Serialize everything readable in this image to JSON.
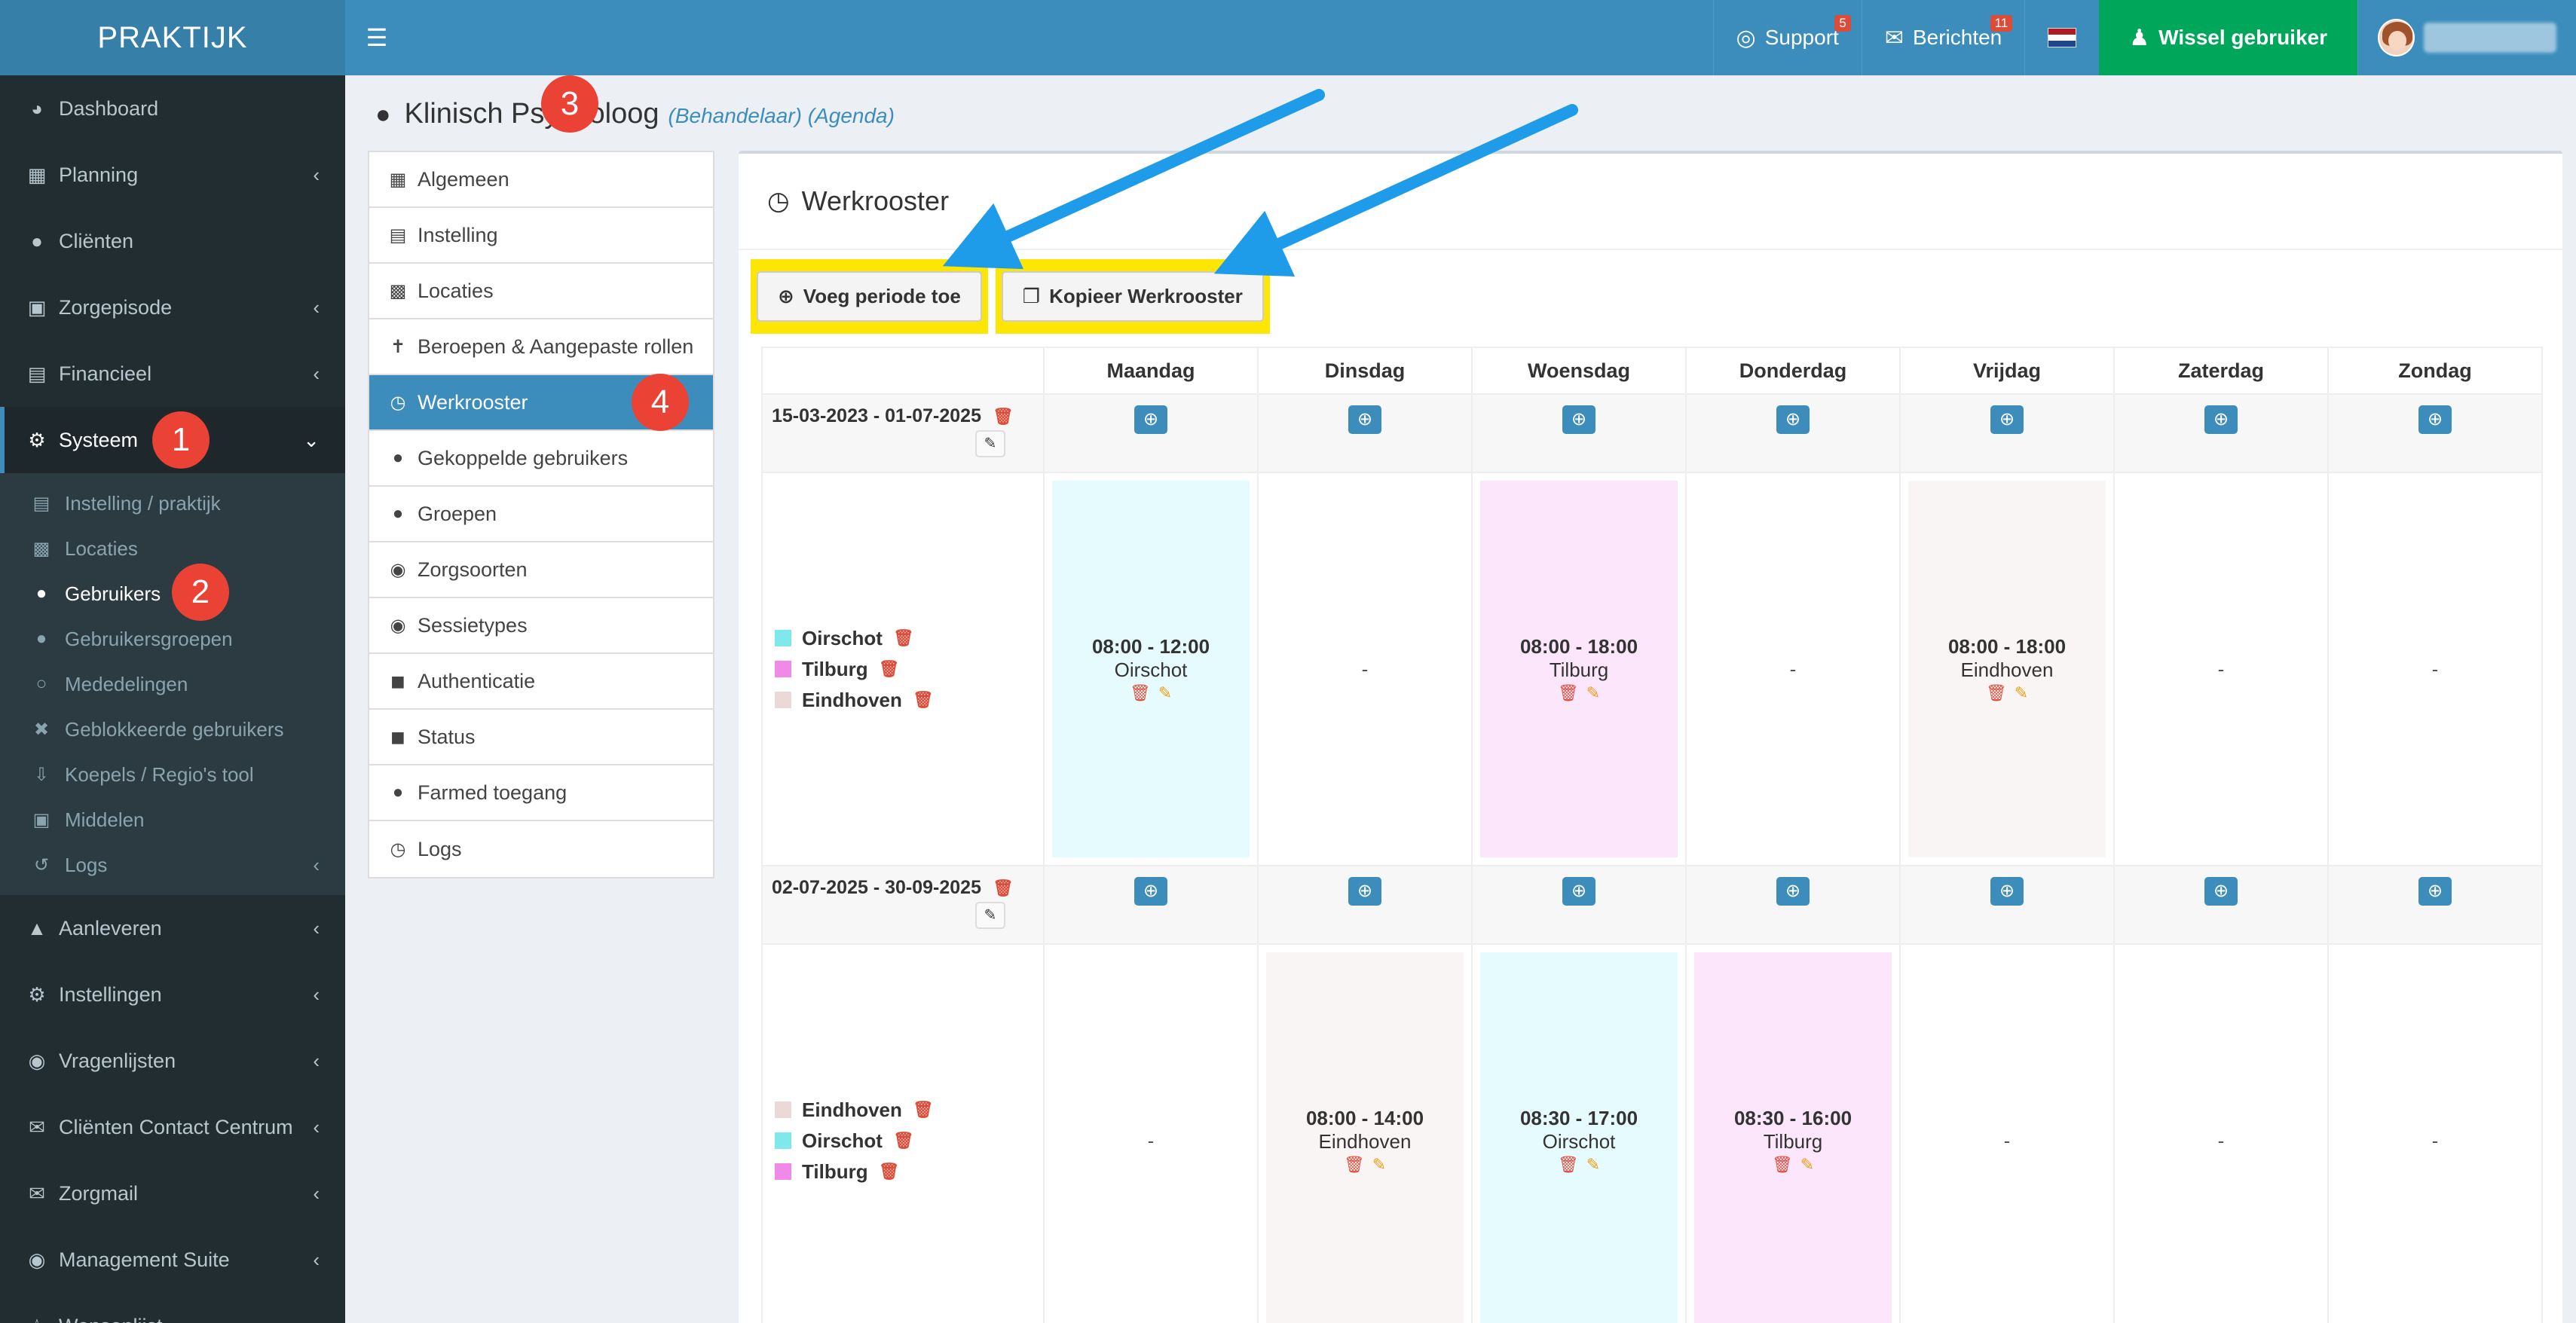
{
  "app": {
    "logo": "PRAKTIJK",
    "menu_icon": "hamburger-icon"
  },
  "topbar": {
    "support": {
      "label": "Support",
      "badge": "5",
      "icon": "lifebuoy-icon"
    },
    "berichten": {
      "label": "Berichten",
      "badge": "11",
      "icon": "envelope-icon"
    },
    "flag": "dutch-flag",
    "wissel": {
      "label": "Wissel gebruiker",
      "icon": "user-secret-icon"
    },
    "user": {
      "avatar": "avatar",
      "name_blurred": true
    }
  },
  "colors": {
    "primary": "#3c8dbc",
    "sidebar": "#222d32",
    "green": "#00a65a",
    "highlight": "#fde504",
    "annotation": "#ea4335",
    "arrow": "#1e9be9"
  },
  "sidebar": {
    "items": [
      {
        "label": "Dashboard",
        "icon": "dashboard-icon",
        "chevron": false
      },
      {
        "label": "Planning",
        "icon": "calendar-icon",
        "chevron": true
      },
      {
        "label": "Cliënten",
        "icon": "user-icon",
        "chevron": false
      },
      {
        "label": "Zorgepisode",
        "icon": "briefcase-medical-icon",
        "chevron": true
      },
      {
        "label": "Financieel",
        "icon": "money-icon",
        "chevron": true
      },
      {
        "label": "Systeem",
        "icon": "cogs-icon",
        "chevron": true,
        "open": true
      }
    ],
    "systeem_sub": [
      {
        "label": "Instelling / praktijk",
        "icon": "clipboard-icon"
      },
      {
        "label": "Locaties",
        "icon": "map-icon"
      },
      {
        "label": "Gebruikers",
        "icon": "user-icon",
        "active": true
      },
      {
        "label": "Gebruikersgroepen",
        "icon": "users-icon"
      },
      {
        "label": "Mededelingen",
        "icon": "comments-icon"
      },
      {
        "label": "Geblokkeerde gebruikers",
        "icon": "user-times-icon"
      },
      {
        "label": "Koepels / Regio's tool",
        "icon": "download-icon"
      },
      {
        "label": "Middelen",
        "icon": "cubes-icon"
      },
      {
        "label": "Logs",
        "icon": "history-icon",
        "chevron": true
      }
    ],
    "items_after": [
      {
        "label": "Aanleveren",
        "icon": "truck-icon"
      },
      {
        "label": "Instellingen",
        "icon": "gear-icon"
      },
      {
        "label": "Vragenlijsten",
        "icon": "globe-icon"
      },
      {
        "label": "Cliënten Contact Centrum",
        "icon": "envelope-icon"
      },
      {
        "label": "Zorgmail",
        "icon": "envelope-icon"
      },
      {
        "label": "Management Suite",
        "icon": "globe-icon"
      },
      {
        "label": "Wensenlijst",
        "icon": "star-icon"
      }
    ]
  },
  "annotations": [
    "1",
    "2",
    "3",
    "4"
  ],
  "page": {
    "title": "Klinisch Psycholoog",
    "subtitle": "(Behandelaar) (Agenda)"
  },
  "leftmenu": [
    {
      "label": "Algemeen",
      "icon": "table-icon"
    },
    {
      "label": "Instelling",
      "icon": "clipboard-icon"
    },
    {
      "label": "Locaties",
      "icon": "map-icon"
    },
    {
      "label": "Beroepen & Aangepaste rollen",
      "icon": "child-icon"
    },
    {
      "label": "Werkrooster",
      "icon": "clock-icon",
      "active": true
    },
    {
      "label": "Gekoppelde gebruikers",
      "icon": "user-icon"
    },
    {
      "label": "Groepen",
      "icon": "users-icon"
    },
    {
      "label": "Zorgsoorten",
      "icon": "globe-icon"
    },
    {
      "label": "Sessietypes",
      "icon": "globe-icon"
    },
    {
      "label": "Authenticatie",
      "icon": "lock-icon"
    },
    {
      "label": "Status",
      "icon": "lock-icon"
    },
    {
      "label": "Farmed toegang",
      "icon": "user-md-icon"
    },
    {
      "label": "Logs",
      "icon": "clock-icon"
    }
  ],
  "werkrooster": {
    "title": "Werkrooster",
    "buttons": {
      "add_period": "Voeg periode toe",
      "copy": "Kopieer Werkrooster"
    },
    "days": [
      "Maandag",
      "Dinsdag",
      "Woensdag",
      "Donderdag",
      "Vrijdag",
      "Zaterdag",
      "Zondag"
    ],
    "periods": [
      {
        "range": "15-03-2023 - 01-07-2025",
        "locations": [
          {
            "name": "Oirschot",
            "color": "#7fe8ec"
          },
          {
            "name": "Tilburg",
            "color": "#f08ae8"
          },
          {
            "name": "Eindhoven",
            "color": "#ecd8d8"
          }
        ],
        "slots": [
          {
            "time": "08:00 - 12:00",
            "loc": "Oirschot",
            "bg": "#e6fbfd"
          },
          {
            "empty": "-"
          },
          {
            "time": "08:00 - 18:00",
            "loc": "Tilburg",
            "bg": "#fbe6fb"
          },
          {
            "empty": "-"
          },
          {
            "time": "08:00 - 18:00",
            "loc": "Eindhoven",
            "bg": "#f9f5f4"
          },
          {
            "empty": "-"
          },
          {
            "empty": "-"
          }
        ]
      },
      {
        "range": "02-07-2025 - 30-09-2025",
        "locations": [
          {
            "name": "Eindhoven",
            "color": "#ecd8d8"
          },
          {
            "name": "Oirschot",
            "color": "#7fe8ec"
          },
          {
            "name": "Tilburg",
            "color": "#f08ae8"
          }
        ],
        "slots": [
          {
            "empty": "-"
          },
          {
            "time": "08:00 - 14:00",
            "loc": "Eindhoven",
            "bg": "#f9f5f4"
          },
          {
            "time": "08:30 - 17:00",
            "loc": "Oirschot",
            "bg": "#e6fbfd"
          },
          {
            "time": "08:30 - 16:00",
            "loc": "Tilburg",
            "bg": "#fbe6fb"
          },
          {
            "empty": "-"
          },
          {
            "empty": "-"
          },
          {
            "empty": "-"
          }
        ]
      }
    ]
  }
}
